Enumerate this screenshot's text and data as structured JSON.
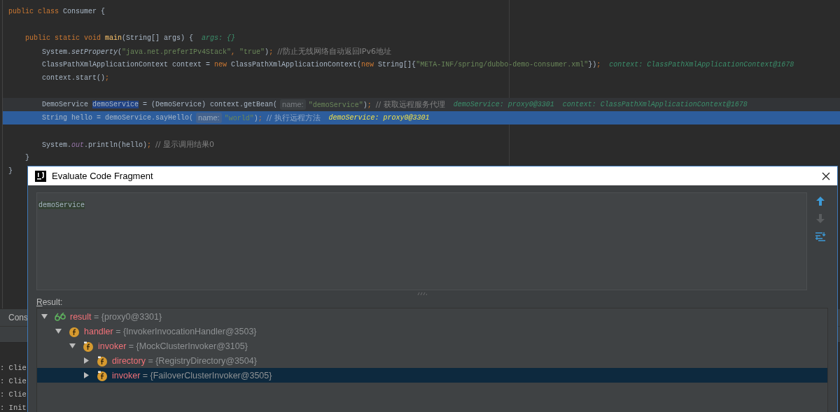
{
  "editor": {
    "lines": [
      {
        "kind": "normal",
        "tokens": [
          {
            "t": "public class ",
            "kind": "kw"
          },
          {
            "t": "Consumer {",
            "kind": "plain"
          }
        ],
        "children": [
          {
            "kind": "blank"
          },
          {
            "kind": "normal",
            "tokens": [
              {
                "t": "public static void ",
                "kind": "kw"
              },
              {
                "t": "main",
                "kind": "fn"
              },
              {
                "t": "(String[] args) {",
                "kind": "plain"
              },
              {
                "t": "args: {}",
                "kind": "hint"
              }
            ],
            "children": [
              {
                "kind": "normal",
                "tokens": [
                  {
                    "t": "System.",
                    "kind": "plain"
                  },
                  {
                    "t": "setProperty",
                    "kind": "italic"
                  },
                  {
                    "t": "(",
                    "kind": "plain"
                  },
                  {
                    "t": "\"java.net.preferIPv4Stack\"",
                    "kind": "str"
                  },
                  {
                    "t": ", ",
                    "kind": "kw"
                  },
                  {
                    "t": "\"true\"",
                    "kind": "str"
                  },
                  {
                    "t": ")",
                    "kind": "plain"
                  },
                  {
                    "t": "; ",
                    "kind": "kw"
                  },
                  {
                    "t": "//防止无线网络自动返回IPv6地址",
                    "kind": "comment"
                  }
                ]
              },
              {
                "kind": "normal",
                "tokens": [
                  {
                    "t": "ClassPathXmlApplicationContext context = ",
                    "kind": "plain"
                  },
                  {
                    "t": "new ",
                    "kind": "kw"
                  },
                  {
                    "t": "ClassPathXmlApplicationContext(",
                    "kind": "plain"
                  },
                  {
                    "t": "new ",
                    "kind": "kw"
                  },
                  {
                    "t": "String[]{",
                    "kind": "plain"
                  },
                  {
                    "t": "\"META-INF/spring/dubbo-demo-consumer.xml\"",
                    "kind": "str"
                  },
                  {
                    "t": "})",
                    "kind": "plain"
                  },
                  {
                    "t": ";",
                    "kind": "kw"
                  },
                  {
                    "t": "context: ClassPathXmlApplicationContext@1678",
                    "kind": "hint"
                  }
                ]
              },
              {
                "kind": "normal",
                "tokens": [
                  {
                    "t": "context.start()",
                    "kind": "plain"
                  },
                  {
                    "t": ";",
                    "kind": "kw"
                  }
                ]
              },
              {
                "kind": "blank"
              },
              {
                "kind": "current",
                "tokens": [
                  {
                    "t": "DemoService ",
                    "kind": "plain"
                  },
                  {
                    "t": "demoService",
                    "kind": "sel"
                  },
                  {
                    "t": " = (DemoService) context.getBean(",
                    "kind": "plain"
                  },
                  {
                    "t": "name:",
                    "kind": "inlay"
                  },
                  {
                    "t": "\"demoService\"",
                    "kind": "str"
                  },
                  {
                    "t": ")",
                    "kind": "plain"
                  },
                  {
                    "t": "; ",
                    "kind": "kw"
                  },
                  {
                    "t": "// 获取远程服务代理",
                    "kind": "comment"
                  },
                  {
                    "t": "demoService: proxy0@3301  context: ClassPathXmlApplicationContext@1678",
                    "kind": "hint"
                  }
                ]
              },
              {
                "kind": "execution",
                "tokens": [
                  {
                    "t": "String hello = demoService.sayHello(",
                    "kind": "plain"
                  },
                  {
                    "t": "name:",
                    "kind": "inlay"
                  },
                  {
                    "t": "\"world\"",
                    "kind": "str"
                  },
                  {
                    "t": ")",
                    "kind": "plain"
                  },
                  {
                    "t": "; ",
                    "kind": "kw"
                  },
                  {
                    "t": "// 执行远程方法",
                    "kind": "comment"
                  },
                  {
                    "t": "demoService: proxy0@3301",
                    "kind": "hint"
                  }
                ]
              },
              {
                "kind": "blank"
              },
              {
                "kind": "normal",
                "tokens": [
                  {
                    "t": "System.",
                    "kind": "plain"
                  },
                  {
                    "t": "out",
                    "kind": "field"
                  },
                  {
                    "t": ".println(hello)",
                    "kind": "plain"
                  },
                  {
                    "t": "; ",
                    "kind": "kw"
                  },
                  {
                    "t": "// 显示调用结果0",
                    "kind": "comment"
                  }
                ]
              }
            ]
          },
          {
            "kind": "normal",
            "tokens": [
              {
                "t": "}",
                "kind": "plain"
              }
            ]
          }
        ]
      },
      {
        "kind": "normal",
        "tokens": [
          {
            "t": "}",
            "kind": "plain"
          }
        ]
      }
    ]
  },
  "console": {
    "tab": "Cons",
    "lines": [
      ": Clie",
      ": Clie",
      ": Clie",
      ": Init"
    ]
  },
  "dialog": {
    "title": "Evaluate Code Fragment",
    "expression": "demoService",
    "toolbar": [
      {
        "kind": "up",
        "disabled": false
      },
      {
        "kind": "down",
        "disabled": true
      },
      {
        "kind": "mode",
        "disabled": false
      }
    ],
    "result_label": "Result:",
    "tree": [
      {
        "name": "result",
        "value": "= {proxy0@3301}",
        "kind": "watch",
        "expanded": true,
        "selected": false,
        "children": [
          {
            "name": "handler",
            "value": "= {InvokerInvocationHandler@3503}",
            "kind": "field",
            "expanded": true,
            "selected": false,
            "children": [
              {
                "name": "invoker",
                "value": "= {MockClusterInvoker@3105}",
                "kind": "final-field",
                "expanded": true,
                "selected": false,
                "children": [
                  {
                    "name": "directory",
                    "value": "= {RegistryDirectory@3504}",
                    "kind": "final-field",
                    "expanded": false,
                    "selected": false
                  },
                  {
                    "name": "invoker",
                    "value": "= {FailoverClusterInvoker@3505}",
                    "kind": "final-field",
                    "expanded": false,
                    "selected": true
                  }
                ]
              }
            ]
          }
        ]
      }
    ]
  }
}
